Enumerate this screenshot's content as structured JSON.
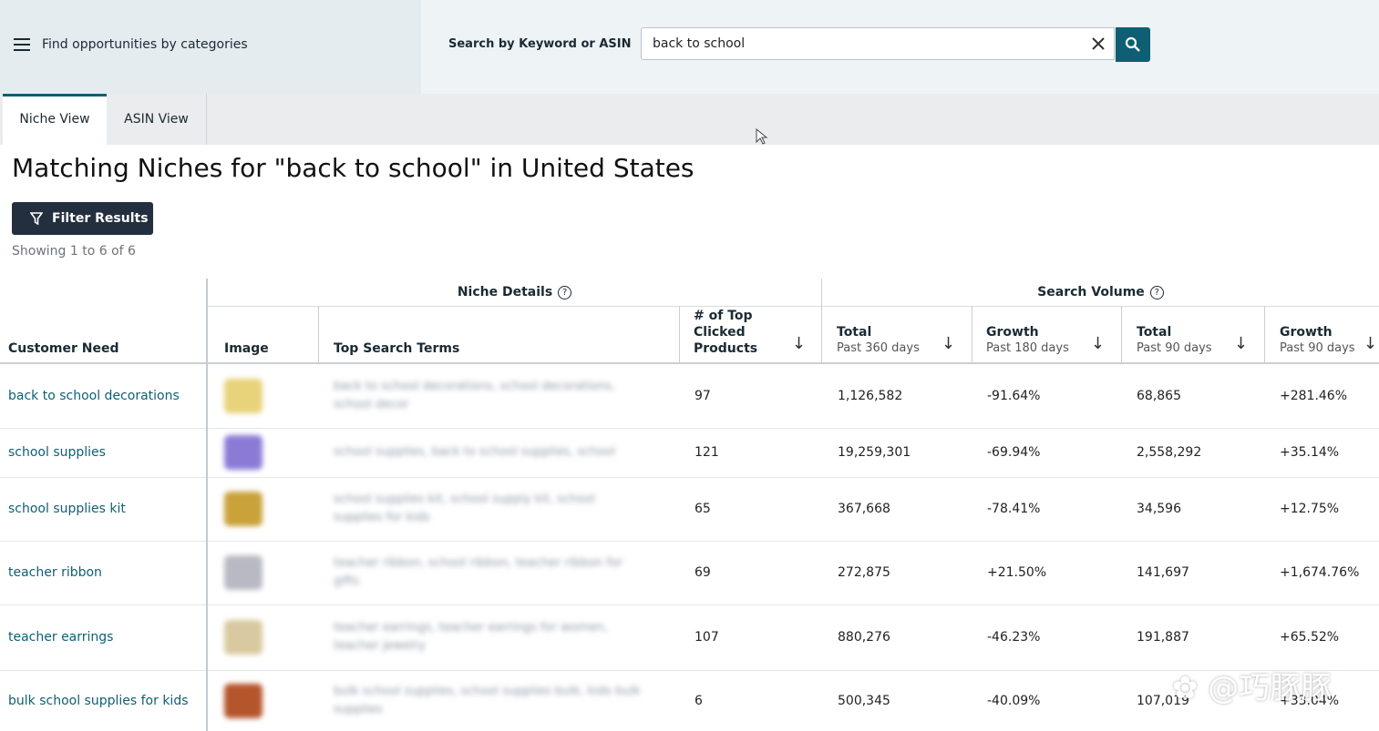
{
  "topbar": {
    "categories_label": "Find opportunities by categories",
    "search_label": "Search by Keyword or ASIN",
    "search_value": "back to school"
  },
  "tabs": [
    {
      "label": "Niche View",
      "active": true
    },
    {
      "label": "ASIN View",
      "active": false
    }
  ],
  "header": {
    "title": "Matching Niches for \"back to school\" in United States",
    "filter_label": "Filter Results",
    "showing": "Showing 1 to 6 of 6"
  },
  "table": {
    "groups": {
      "niche_details": "Niche Details",
      "search_volume": "Search Volume"
    },
    "columns": {
      "customer_need": "Customer Need",
      "image": "Image",
      "top_search_terms": "Top Search Terms",
      "top_clicked": "# of Top Clicked Products",
      "total_360": {
        "title": "Total",
        "sub": "Past 360 days"
      },
      "growth_180": {
        "title": "Growth",
        "sub": "Past 180 days"
      },
      "total_90": {
        "title": "Total",
        "sub": "Past 90 days"
      },
      "growth_90": {
        "title": "Growth",
        "sub": "Past 90 days"
      }
    },
    "rows": [
      {
        "need": "back to school decorations",
        "clicked": "97",
        "total360": "1,126,582",
        "growth180": "-91.64%",
        "total90": "68,865",
        "growth90": "+281.46%",
        "thumb_color": "#e8d27a"
      },
      {
        "need": "school supplies",
        "clicked": "121",
        "total360": "19,259,301",
        "growth180": "-69.94%",
        "total90": "2,558,292",
        "growth90": "+35.14%",
        "thumb_color": "#8c7bd6"
      },
      {
        "need": "school supplies kit",
        "clicked": "65",
        "total360": "367,668",
        "growth180": "-78.41%",
        "total90": "34,596",
        "growth90": "+12.75%",
        "thumb_color": "#c9a23a"
      },
      {
        "need": "teacher ribbon",
        "clicked": "69",
        "total360": "272,875",
        "growth180": "+21.50%",
        "total90": "141,697",
        "growth90": "+1,674.76%",
        "thumb_color": "#b9b9c4"
      },
      {
        "need": "teacher earrings",
        "clicked": "107",
        "total360": "880,276",
        "growth180": "-46.23%",
        "total90": "191,887",
        "growth90": "+65.52%",
        "thumb_color": "#d8c9a0"
      },
      {
        "need": "bulk school supplies for kids",
        "clicked": "6",
        "total360": "500,345",
        "growth180": "-40.09%",
        "total90": "107,019",
        "growth90": "+33.04%",
        "thumb_color": "#b5552c"
      }
    ]
  },
  "watermark": "@巧豚豚"
}
